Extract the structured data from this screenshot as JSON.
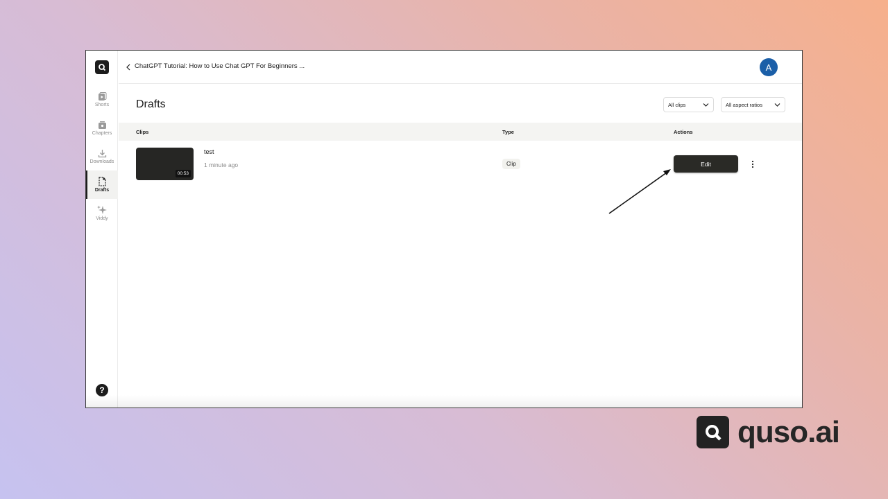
{
  "sidebar": {
    "items": [
      {
        "label": "Shorts",
        "icon": "shorts-icon",
        "active": false
      },
      {
        "label": "Chapters",
        "icon": "chapters-icon",
        "active": false
      },
      {
        "label": "Downloads",
        "icon": "download-icon",
        "active": false
      },
      {
        "label": "Drafts",
        "icon": "drafts-icon",
        "active": true
      },
      {
        "label": "Viddy",
        "icon": "sparkle-icon",
        "active": false
      }
    ],
    "help_label": "?"
  },
  "header": {
    "breadcrumb": "ChatGPT Tutorial: How to Use Chat GPT For Beginners ...",
    "avatar_initial": "A",
    "avatar_color": "#1b5fa8"
  },
  "main": {
    "title": "Drafts",
    "filters": {
      "clips": "All clips",
      "aspect": "All aspect ratios"
    },
    "table": {
      "headers": {
        "clips": "Clips",
        "type": "Type",
        "actions": "Actions"
      },
      "rows": [
        {
          "title": "test",
          "time": "1 minute ago",
          "duration": "00:53",
          "type": "Clip",
          "action": "Edit"
        }
      ]
    }
  },
  "brand": {
    "name": "quso.ai"
  }
}
